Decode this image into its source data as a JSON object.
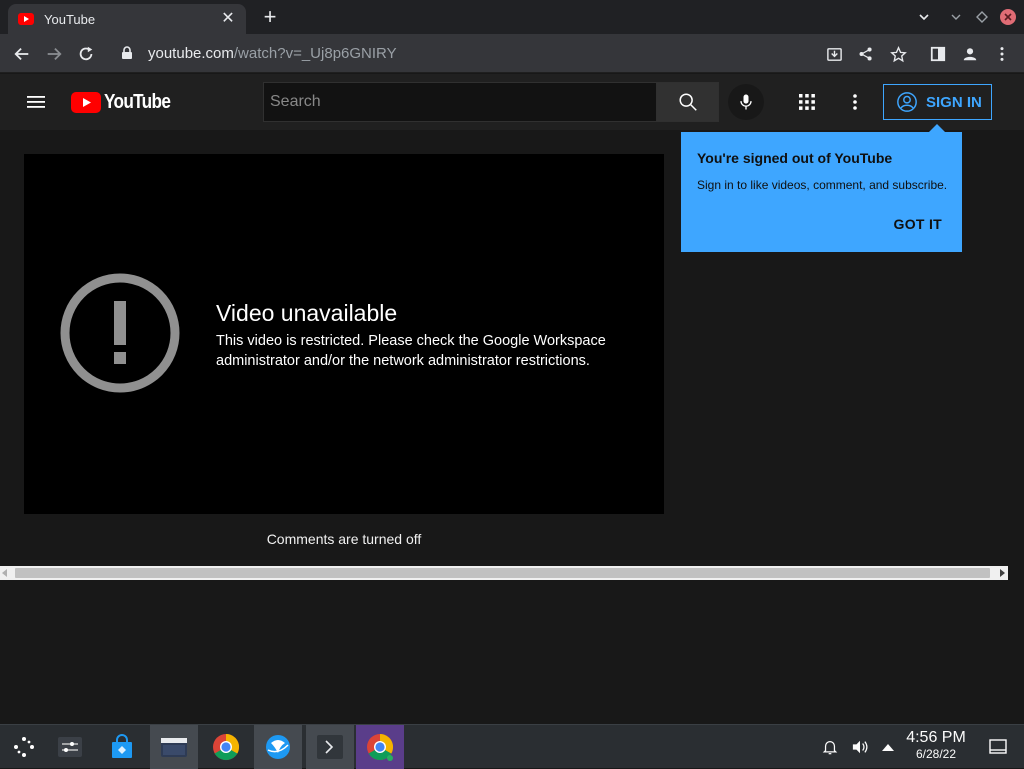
{
  "browser": {
    "tab_title": "YouTube",
    "new_tab_label": "+",
    "url_host": "youtube.com",
    "url_path": "/watch?v=_Uj8p6GNIRY"
  },
  "youtube": {
    "logo_text": "YouTube",
    "search_placeholder": "Search",
    "sign_in_label": "SIGN IN",
    "player": {
      "error_title": "Video unavailable",
      "error_message": "This video is restricted. Please check the Google Workspace administrator and/or the network administrator restrictions."
    },
    "comments_status": "Comments are turned off",
    "tooltip": {
      "title": "You're signed out of YouTube",
      "body": "Sign in to like videos, comment, and subscribe.",
      "button": "GOT IT"
    }
  },
  "taskbar": {
    "time": "4:56 PM",
    "date": "6/28/22"
  },
  "colors": {
    "accent": "#3ea6ff",
    "youtube_red": "#ff0000",
    "page_bg": "#181818",
    "header_bg": "#202020"
  }
}
